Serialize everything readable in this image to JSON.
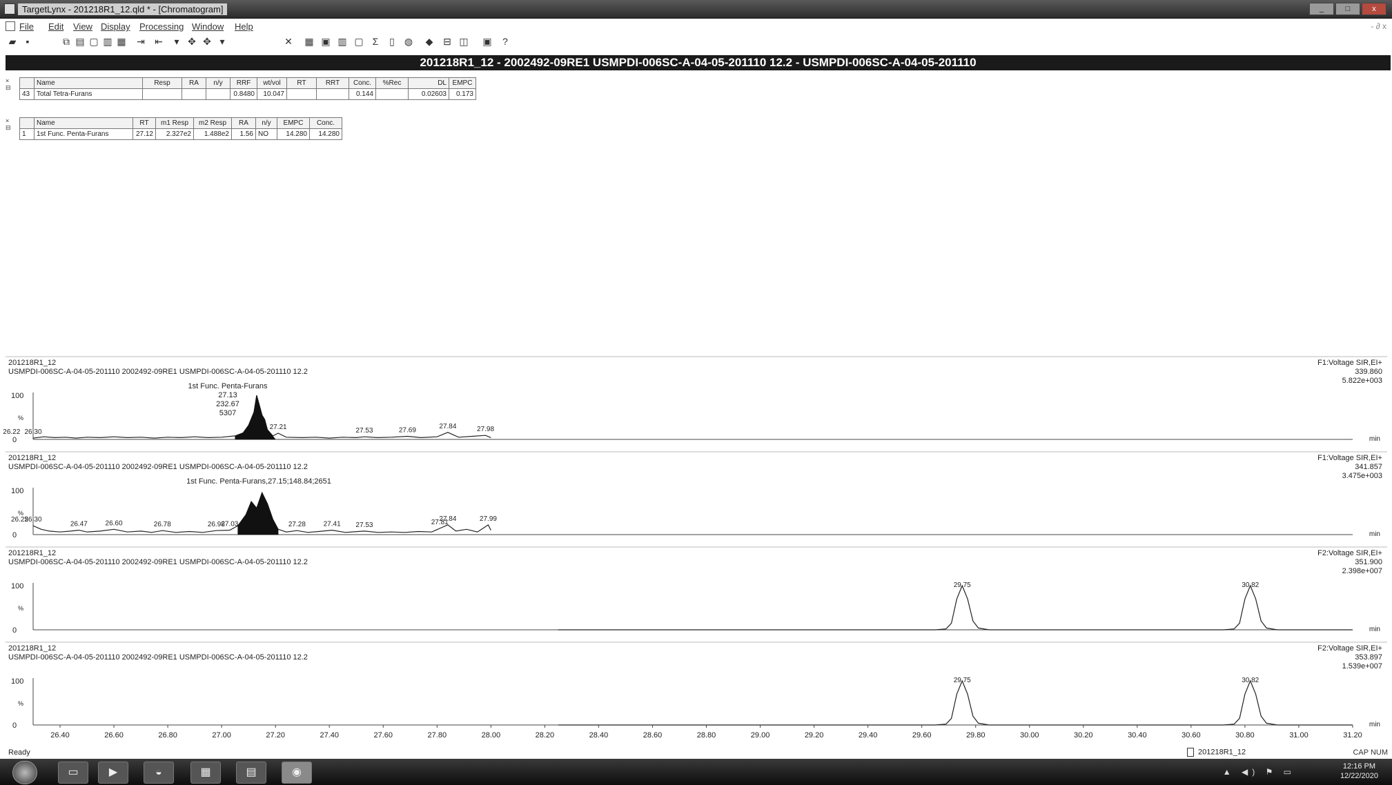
{
  "window": {
    "title": "TargetLynx - 201218R1_12.qld * - [Chromatogram]",
    "controls": [
      "_",
      "□",
      "x"
    ]
  },
  "menu": {
    "items": [
      "File",
      "Edit",
      "View",
      "Display",
      "Processing",
      "Window",
      "Help"
    ],
    "right_controls": "- ∂ x"
  },
  "toolbar": {
    "icons": [
      "open-icon",
      "save-icon",
      "copy-icon",
      "paste-icon",
      "page-icon",
      "print-preview-icon",
      "arrow-left-icon",
      "arrow-right-icon",
      "move-icon",
      "delete-icon",
      "grid-icon",
      "chart-icon",
      "bar-icon",
      "square-icon",
      "sum-icon",
      "book-icon",
      "globe-icon",
      "eraser-icon",
      "window-icon",
      "split-icon",
      "print-icon",
      "help-icon"
    ]
  },
  "header": {
    "text": "201218R1_12 - 2002492-09RE1 USMPDI-006SC-A-04-05-201110 12.2 - USMPDI-006SC-A-04-05-201110"
  },
  "table1": {
    "headers": [
      "",
      "Name",
      "Resp",
      "RA",
      "n/y",
      "RRF",
      "wt/vol",
      "RT",
      "RRT",
      "Conc.",
      "%Rec",
      "DL",
      "EMPC"
    ],
    "rows": [
      [
        "43",
        "Total Tetra-Furans",
        "",
        "",
        "",
        "0.8480",
        "10.047",
        "",
        "",
        "0.144",
        "",
        "0.02603",
        "0.173"
      ]
    ]
  },
  "table2": {
    "headers": [
      "",
      "Name",
      "RT",
      "m1 Resp",
      "m2 Resp",
      "RA",
      "n/y",
      "EMPC",
      "Conc."
    ],
    "rows": [
      [
        "1",
        "1st Func. Penta-Furans",
        "27.12",
        "2.327e2",
        "1.488e2",
        "1.56",
        "NO",
        "14.280",
        "14.280"
      ]
    ]
  },
  "chart_data": {
    "type": "line",
    "xlim": [
      26.3,
      31.2
    ],
    "x_unit": "min",
    "x_ticks": [
      "26.40",
      "26.60",
      "26.80",
      "27.00",
      "27.20",
      "27.40",
      "27.60",
      "27.80",
      "28.00",
      "28.20",
      "28.40",
      "28.60",
      "28.80",
      "29.00",
      "29.20",
      "29.40",
      "29.60",
      "29.80",
      "30.00",
      "30.20",
      "30.40",
      "30.60",
      "30.80",
      "31.00",
      "31.20"
    ],
    "panels": [
      {
        "sample": "201218R1_12",
        "desc": "USMPDI-006SC-A-04-05-201110 2002492-09RE1 USMPDI-006SC-A-04-05-201110 12.2",
        "func": "F1:Voltage SIR,EI+",
        "mass": "339.860",
        "intensity": "5.822e+003",
        "ylabels": [
          "100",
          "%",
          "0"
        ],
        "xunit_label": "min",
        "annotation": [
          "1st Func. Penta-Furans",
          "27.13",
          "232.67",
          "5307"
        ],
        "peak_labels": [
          {
            "x": 26.22,
            "t": "26.22"
          },
          {
            "x": 26.3,
            "t": "26.30"
          },
          {
            "x": 27.21,
            "t": "27.21"
          },
          {
            "x": 27.53,
            "t": "27.53"
          },
          {
            "x": 27.69,
            "t": "27.69"
          },
          {
            "x": 27.84,
            "t": "27.84"
          },
          {
            "x": 27.98,
            "t": "27.98"
          }
        ],
        "trace": [
          [
            26.3,
            0.03
          ],
          [
            26.34,
            0.06
          ],
          [
            26.38,
            0.04
          ],
          [
            26.42,
            0.05
          ],
          [
            26.46,
            0.03
          ],
          [
            26.5,
            0.05
          ],
          [
            26.55,
            0.04
          ],
          [
            26.6,
            0.06
          ],
          [
            26.65,
            0.04
          ],
          [
            26.7,
            0.05
          ],
          [
            26.75,
            0.03
          ],
          [
            26.8,
            0.05
          ],
          [
            26.85,
            0.04
          ],
          [
            26.9,
            0.06
          ],
          [
            26.95,
            0.04
          ],
          [
            27.0,
            0.05
          ],
          [
            27.05,
            0.08
          ],
          [
            27.08,
            0.15
          ],
          [
            27.1,
            0.32
          ],
          [
            27.12,
            0.62
          ],
          [
            27.13,
            1.0
          ],
          [
            27.14,
            0.78
          ],
          [
            27.15,
            0.55
          ],
          [
            27.16,
            0.45
          ],
          [
            27.17,
            0.22
          ],
          [
            27.19,
            0.08
          ],
          [
            27.21,
            0.14
          ],
          [
            27.24,
            0.05
          ],
          [
            27.3,
            0.04
          ],
          [
            27.35,
            0.05
          ],
          [
            27.4,
            0.03
          ],
          [
            27.45,
            0.05
          ],
          [
            27.5,
            0.04
          ],
          [
            27.53,
            0.06
          ],
          [
            27.58,
            0.04
          ],
          [
            27.63,
            0.05
          ],
          [
            27.69,
            0.07
          ],
          [
            27.74,
            0.04
          ],
          [
            27.8,
            0.06
          ],
          [
            27.84,
            0.16
          ],
          [
            27.88,
            0.05
          ],
          [
            27.93,
            0.07
          ],
          [
            27.98,
            0.09
          ],
          [
            28.0,
            0.04
          ]
        ],
        "fill": [
          27.05,
          27.2
        ]
      },
      {
        "sample": "201218R1_12",
        "desc": "USMPDI-006SC-A-04-05-201110 2002492-09RE1 USMPDI-006SC-A-04-05-201110 12.2",
        "func": "F1:Voltage SIR,EI+",
        "mass": "341.857",
        "intensity": "3.475e+003",
        "ylabels": [
          "100",
          "%",
          "0"
        ],
        "xunit_label": "min",
        "annotation": [
          "1st Func. Penta-Furans,27.15;148.84;2651"
        ],
        "peak_labels": [
          {
            "x": 26.25,
            "t": "26.25"
          },
          {
            "x": 26.3,
            "t": "26.30"
          },
          {
            "x": 26.47,
            "t": "26.47"
          },
          {
            "x": 26.6,
            "t": "26.60"
          },
          {
            "x": 26.78,
            "t": "26.78"
          },
          {
            "x": 26.98,
            "t": "26.98"
          },
          {
            "x": 27.03,
            "t": "27.03"
          },
          {
            "x": 27.28,
            "t": "27.28"
          },
          {
            "x": 27.41,
            "t": "27.41"
          },
          {
            "x": 27.53,
            "t": "27.53"
          },
          {
            "x": 27.81,
            "t": "27.81"
          },
          {
            "x": 27.84,
            "t": "27.84"
          },
          {
            "x": 27.99,
            "t": "27.99"
          }
        ],
        "trace": [
          [
            26.3,
            0.2
          ],
          [
            26.33,
            0.12
          ],
          [
            26.36,
            0.08
          ],
          [
            26.4,
            0.06
          ],
          [
            26.44,
            0.08
          ],
          [
            26.47,
            0.1
          ],
          [
            26.5,
            0.06
          ],
          [
            26.55,
            0.08
          ],
          [
            26.6,
            0.12
          ],
          [
            26.65,
            0.06
          ],
          [
            26.7,
            0.08
          ],
          [
            26.74,
            0.05
          ],
          [
            26.78,
            0.09
          ],
          [
            26.83,
            0.05
          ],
          [
            26.88,
            0.07
          ],
          [
            26.93,
            0.05
          ],
          [
            26.98,
            0.09
          ],
          [
            27.03,
            0.1
          ],
          [
            27.06,
            0.2
          ],
          [
            27.09,
            0.45
          ],
          [
            27.11,
            0.75
          ],
          [
            27.13,
            0.6
          ],
          [
            27.15,
            0.95
          ],
          [
            27.17,
            0.7
          ],
          [
            27.19,
            0.35
          ],
          [
            27.21,
            0.12
          ],
          [
            27.24,
            0.06
          ],
          [
            27.28,
            0.09
          ],
          [
            27.32,
            0.05
          ],
          [
            27.36,
            0.07
          ],
          [
            27.41,
            0.1
          ],
          [
            27.46,
            0.05
          ],
          [
            27.53,
            0.08
          ],
          [
            27.58,
            0.05
          ],
          [
            27.63,
            0.06
          ],
          [
            27.68,
            0.05
          ],
          [
            27.73,
            0.07
          ],
          [
            27.78,
            0.06
          ],
          [
            27.81,
            0.14
          ],
          [
            27.84,
            0.22
          ],
          [
            27.87,
            0.08
          ],
          [
            27.91,
            0.12
          ],
          [
            27.95,
            0.06
          ],
          [
            27.99,
            0.22
          ],
          [
            28.0,
            0.1
          ]
        ],
        "fill": [
          27.06,
          27.21
        ]
      },
      {
        "sample": "201218R1_12",
        "desc": "USMPDI-006SC-A-04-05-201110 2002492-09RE1 USMPDI-006SC-A-04-05-201110 12.2",
        "func": "F2:Voltage SIR,EI+",
        "mass": "351.900",
        "intensity": "2.398e+007",
        "ylabels": [
          "100",
          "%",
          "0"
        ],
        "xunit_label": "min",
        "annotation": [],
        "peak_labels": [
          {
            "x": 29.75,
            "t": "29.75"
          },
          {
            "x": 30.82,
            "t": "30.82"
          }
        ],
        "trace": [
          [
            28.25,
            0.0
          ],
          [
            29.65,
            0.0
          ],
          [
            29.69,
            0.02
          ],
          [
            29.71,
            0.15
          ],
          [
            29.73,
            0.7
          ],
          [
            29.75,
            1.0
          ],
          [
            29.77,
            0.7
          ],
          [
            29.79,
            0.2
          ],
          [
            29.81,
            0.04
          ],
          [
            29.85,
            0.0
          ],
          [
            30.72,
            0.0
          ],
          [
            30.76,
            0.02
          ],
          [
            30.78,
            0.15
          ],
          [
            30.8,
            0.7
          ],
          [
            30.82,
            1.0
          ],
          [
            30.84,
            0.7
          ],
          [
            30.86,
            0.2
          ],
          [
            30.88,
            0.04
          ],
          [
            30.92,
            0.0
          ],
          [
            31.2,
            0.0
          ]
        ],
        "fill": null
      },
      {
        "sample": "201218R1_12",
        "desc": "USMPDI-006SC-A-04-05-201110 2002492-09RE1 USMPDI-006SC-A-04-05-201110 12.2",
        "func": "F2:Voltage SIR,EI+",
        "mass": "353.897",
        "intensity": "1.539e+007",
        "ylabels": [
          "100",
          "%",
          "0"
        ],
        "xunit_label": "min",
        "annotation": [],
        "peak_labels": [
          {
            "x": 29.75,
            "t": "29.75"
          },
          {
            "x": 30.82,
            "t": "30.82"
          }
        ],
        "trace": [
          [
            28.25,
            0.0
          ],
          [
            29.65,
            0.0
          ],
          [
            29.69,
            0.02
          ],
          [
            29.71,
            0.15
          ],
          [
            29.73,
            0.7
          ],
          [
            29.75,
            1.0
          ],
          [
            29.77,
            0.7
          ],
          [
            29.79,
            0.2
          ],
          [
            29.81,
            0.04
          ],
          [
            29.85,
            0.0
          ],
          [
            30.72,
            0.0
          ],
          [
            30.76,
            0.02
          ],
          [
            30.78,
            0.15
          ],
          [
            30.8,
            0.7
          ],
          [
            30.82,
            1.0
          ],
          [
            30.84,
            0.7
          ],
          [
            30.86,
            0.2
          ],
          [
            30.88,
            0.04
          ],
          [
            30.92,
            0.0
          ],
          [
            31.2,
            0.0
          ]
        ],
        "fill": null
      }
    ]
  },
  "status": {
    "left": "Ready",
    "doc": "201218R1_12",
    "right": "CAP  NUM"
  },
  "taskbar": {
    "items": [
      "explorer-icon",
      "media-icon",
      "app-icon",
      "folder-icon",
      "document-icon",
      "targetlynx-icon"
    ],
    "tray": "▲ ◀) ⚑ ▭",
    "time": "12:16 PM",
    "date": "12/22/2020"
  }
}
